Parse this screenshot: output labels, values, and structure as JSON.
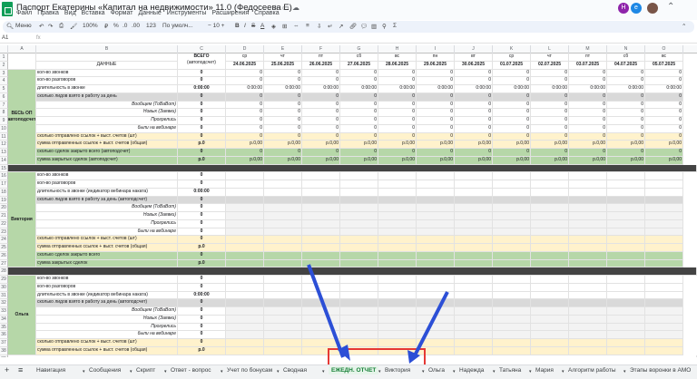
{
  "app": {
    "title": "Паспорт Екатерины «Капитал на недвижимости» 11.0 (Федосеева Е)",
    "name_box": "A1",
    "zoom": "100%",
    "font": "По умолч...",
    "menu_label": "Меню"
  },
  "menu": [
    "Файл",
    "Правка",
    "Вид",
    "Вставка",
    "Формат",
    "Данные",
    "Инструменты",
    "Расширения",
    "Справка"
  ],
  "avatars": [
    {
      "letter": "H",
      "color": "#8e24aa"
    },
    {
      "letter": "e",
      "color": "#1e88e5"
    }
  ],
  "colors": {
    "green": "#b6d7a8",
    "yellow": "#fff2cc",
    "gray": "#d9d9d9",
    "dark": "#434343",
    "accent": "#188038",
    "arrow": "#2c4fd6",
    "highlight": "#e53935"
  },
  "columns": [
    "A",
    "B",
    "C",
    "D",
    "E",
    "F",
    "G",
    "H",
    "I",
    "J",
    "K",
    "L",
    "M",
    "N",
    "O"
  ],
  "header": {
    "c_label": "ВСЕГО",
    "c_sub": "(автоподсчет)",
    "b_label": "ДАННЫЕ",
    "days": [
      "ср",
      "чт",
      "пт",
      "сб",
      "вс",
      "пн",
      "вт",
      "ср",
      "чт",
      "пт",
      "сб",
      "вс"
    ],
    "dates": [
      "24.06.2025",
      "25.06.2025",
      "26.06.2025",
      "27.06.2025",
      "28.06.2025",
      "29.06.2025",
      "30.06.2025",
      "01.07.2025",
      "02.07.2025",
      "03.07.2025",
      "04.07.2025",
      "05.07.2025"
    ]
  },
  "sections": [
    {
      "label": "ВЕСЬ ОП (автоподсчет)",
      "rows": [
        {
          "n": 3,
          "b": "кол-во звонков",
          "c": "0",
          "v": "0"
        },
        {
          "n": 4,
          "b": "кол-во разговоров",
          "c": "0",
          "v": "0"
        },
        {
          "n": 5,
          "b": "длительность в звонке",
          "c": "0:00:00",
          "v": "0:00:00"
        },
        {
          "n": 6,
          "b": "сколько лидов взято в работу за день",
          "c": "0",
          "v": "0"
        },
        {
          "n": 7,
          "b": "Вообщем (ТоВаВот)",
          "c": "0",
          "v": "0"
        },
        {
          "n": 8,
          "b": "Новых (Заявки)",
          "c": "0",
          "v": "0"
        },
        {
          "n": 9,
          "b": "Прогрелись",
          "c": "0",
          "v": "0"
        },
        {
          "n": 10,
          "b": "были на вебинаре",
          "c": "0",
          "v": "0"
        },
        {
          "n": 11,
          "b": "сколько отправлено ссылок + выст. счетов (шт)",
          "c": "0",
          "v": "0"
        },
        {
          "n": 12,
          "b": "сумма отправленных ссылок + выст. счетов (общая)",
          "c": "р.0",
          "v": "р.0,00"
        },
        {
          "n": 13,
          "b": "сколько сделок закрыто всего (автоподсчет)",
          "c": "0",
          "v": "0"
        },
        {
          "n": 14,
          "b": "сумма закрытых сделок (автоподсчет)",
          "c": "р.0",
          "v": "р.0,00"
        }
      ]
    },
    {
      "label": "Виктория",
      "rows": [
        {
          "n": 16,
          "b": "кол-во звонков",
          "c": "0"
        },
        {
          "n": 17,
          "b": "кол-во разговоров",
          "c": "0"
        },
        {
          "n": 18,
          "b": "длительность в звонке (индикатор вебинара наката)",
          "c": "0:00:00"
        },
        {
          "n": 19,
          "b": "сколько лидов взято в работу за день (автоподсчет)",
          "c": "0"
        },
        {
          "n": 20,
          "b": "Вообщем (ТоВаВот)",
          "c": "0"
        },
        {
          "n": 21,
          "b": "Новых (Заявки)",
          "c": "0"
        },
        {
          "n": 22,
          "b": "Прогрелись",
          "c": "0"
        },
        {
          "n": 23,
          "b": "были на вебинаре",
          "c": "0"
        },
        {
          "n": 24,
          "b": "сколько отправлено ссылок + выст. счетов (шт)",
          "c": "0"
        },
        {
          "n": 25,
          "b": "сумма отправленных ссылок + выст. счетов (общая)",
          "c": "р.0"
        },
        {
          "n": 26,
          "b": "сколько сделок закрыто всего",
          "c": "0"
        },
        {
          "n": 27,
          "b": "сумма закрытых сделок",
          "c": "р.0"
        }
      ]
    },
    {
      "label": "Ольга",
      "rows": [
        {
          "n": 29,
          "b": "кол-во звонков",
          "c": "0"
        },
        {
          "n": 30,
          "b": "кол-во разговоров",
          "c": "0"
        },
        {
          "n": 31,
          "b": "длительность в звонке (индикатор вебинара наката)",
          "c": "0:00:00"
        },
        {
          "n": 32,
          "b": "сколько лидов взято в работу за день (автоподсчет)",
          "c": "0"
        },
        {
          "n": 33,
          "b": "Вообщем (ТоВаВот)",
          "c": "0"
        },
        {
          "n": 34,
          "b": "Новых (Заявки)",
          "c": "0"
        },
        {
          "n": 35,
          "b": "Прогрелись",
          "c": "0"
        },
        {
          "n": 36,
          "b": "были на вебинаре",
          "c": "0"
        },
        {
          "n": 37,
          "b": "сколько отправлено ссылок + выст. счетов (шт)",
          "c": "0"
        },
        {
          "n": 38,
          "b": "сумма отправленных ссылок + выст. счетов (общая)",
          "c": "р.0"
        }
      ]
    }
  ],
  "tabs": [
    "Навигация",
    "Сообщения",
    "Скрипт",
    "Ответ - вопрос",
    "Учет по бонусам",
    "Сводная",
    "ЕЖЕДН. ОТЧЕТ",
    "Виктория",
    "Ольга",
    "Надежда",
    "Татьяна",
    "Мария",
    "Алгоритм работы",
    "Этапы воронки в АМО"
  ],
  "active_tab": "ЕЖЕДН. ОТЧЕТ"
}
